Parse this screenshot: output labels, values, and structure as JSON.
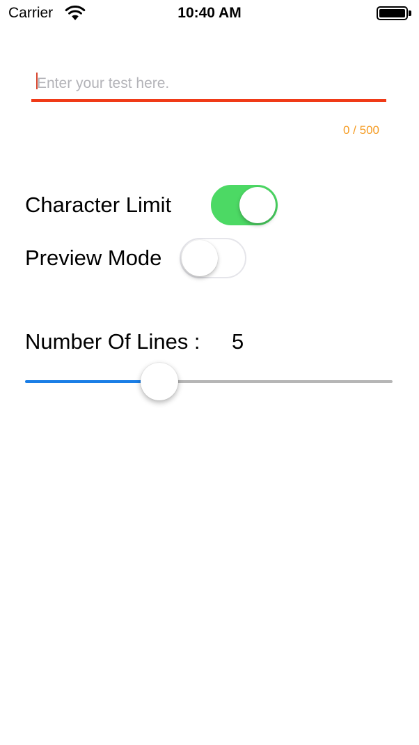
{
  "status_bar": {
    "carrier": "Carrier",
    "time": "10:40 AM",
    "icons": [
      "wifi-icon",
      "battery-icon"
    ]
  },
  "text_input": {
    "value": "",
    "placeholder": "Enter your test here.",
    "underline_color": "#f03a17"
  },
  "char_count": {
    "text": "0 / 500",
    "color": "#f59b21"
  },
  "toggles": {
    "character_limit": {
      "label": "Character Limit",
      "on": true,
      "on_color": "#4cd964"
    },
    "preview_mode": {
      "label": "Preview Mode",
      "on": false
    }
  },
  "lines": {
    "label": "Number Of Lines :",
    "value": "5",
    "slider_fraction": 0.35,
    "min_track_color": "#1a7ee6",
    "max_track_color": "#b6b6b6"
  }
}
